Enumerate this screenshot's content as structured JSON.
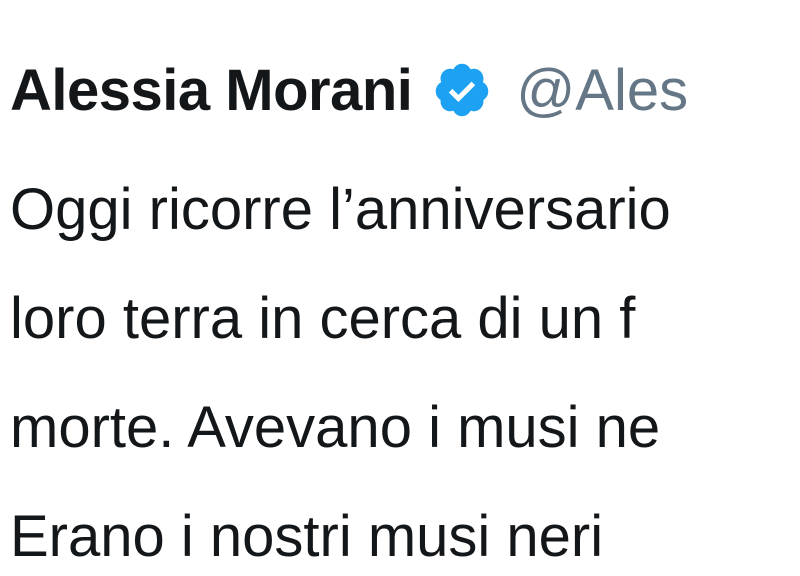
{
  "tweet": {
    "author": {
      "display_name": "Alessia Morani",
      "handle": "@Ales",
      "verified_icon": "verified-badge-icon",
      "verified_color": "#1da1f2"
    },
    "lines": [
      "Oggi ricorre l’anniversario",
      "loro terra in cerca di un f",
      "morte. Avevano i musi ne",
      "Erano i nostri musi neri"
    ]
  }
}
